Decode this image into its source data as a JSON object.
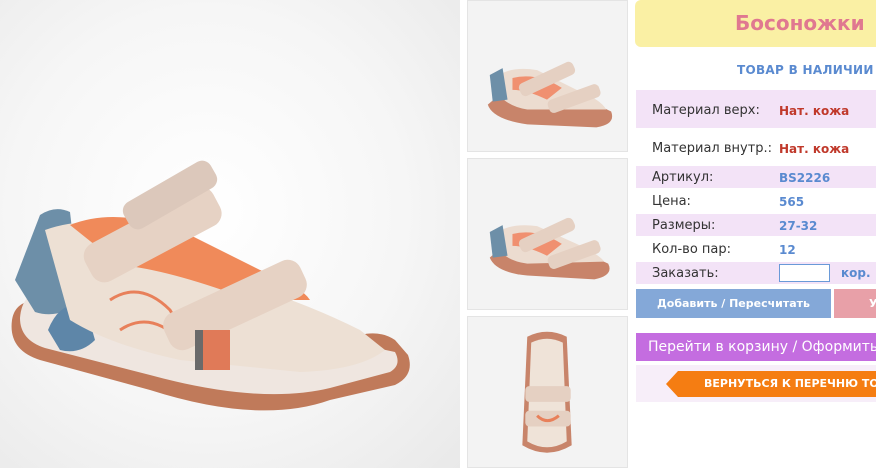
{
  "product": {
    "title": "Босоножки",
    "stock_status": "ТОВАР В НАЛИЧИИ"
  },
  "specs": [
    {
      "label": "Материал верх:",
      "value": "Нат. кожа"
    },
    {
      "label": "Материал внутр.:",
      "value": "Нат. кожа"
    },
    {
      "label": "Артикул:",
      "value": "BS2226"
    },
    {
      "label": "Цена:",
      "value": "565"
    },
    {
      "label": "Размеры:",
      "value": "27-32"
    },
    {
      "label": "Кол-во пар:",
      "value": "12"
    }
  ],
  "order": {
    "label": "Заказать:",
    "quantity_value": "",
    "unit": "кор."
  },
  "buttons": {
    "add_label": "Добавить / Пересчитать",
    "delete_label": "У",
    "cart_label": "Перейти в корзину / Оформить",
    "back_label": "ВЕРНУТЬСЯ К ПЕРЕЧНЮ ТОВАРОВ"
  },
  "colors": {
    "title_bg": "#faf0a4",
    "title_text": "#e07890",
    "accent_blue": "#5a8ad0",
    "value_red": "#c0392b",
    "cart_purple": "#c46de0",
    "back_orange": "#f57d12"
  },
  "images": {
    "main": "sandal-photo-side",
    "thumbs": [
      "sandal-thumb-side",
      "sandal-thumb-side-2",
      "sandal-thumb-top"
    ]
  }
}
